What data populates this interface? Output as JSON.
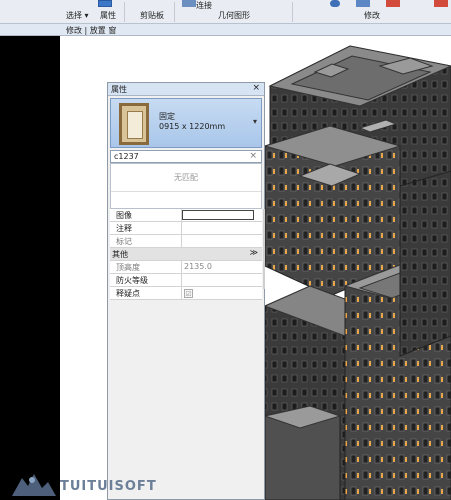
{
  "ribbon": {
    "select_label": "选择",
    "select_caret": "▾",
    "properties_label": "属性",
    "clipboard_label": "剪贴板",
    "geometry_label": "几何图形",
    "modify_label": "修改",
    "connect_label": "连接"
  },
  "context_bar": {
    "text": "修改 | 放置 窗"
  },
  "properties": {
    "title": "属性",
    "close": "×",
    "type_name": "固定",
    "type_size": "0915 x 1220mm",
    "type_caret": "▾",
    "search_value": "c1237",
    "search_clear": "×",
    "no_match": "无匹配",
    "rows": [
      {
        "key": "图像",
        "value": "",
        "kind": "edit"
      },
      {
        "key": "注释",
        "value": "",
        "kind": "text"
      },
      {
        "key": "标记",
        "value": "",
        "kind": "text"
      }
    ],
    "group_other": "其他",
    "group_chev": "≫",
    "other_rows": [
      {
        "key": "顶高度",
        "value": "2135.0"
      },
      {
        "key": "防火等级",
        "value": ""
      },
      {
        "key": "释疑点",
        "value": "☑"
      }
    ]
  },
  "watermark": {
    "text": "TUITUISOFT"
  },
  "colors": {
    "building_wall": "#3a3a3a",
    "building_roof": "#8a8a8a",
    "window_orange": "#e8a64a"
  }
}
